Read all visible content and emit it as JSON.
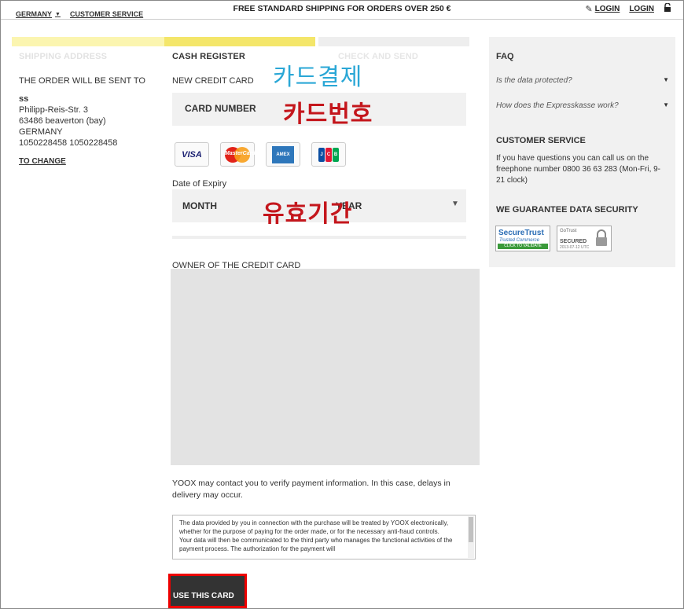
{
  "topbar": {
    "country": "GERMANY",
    "customer_service": "CUSTOMER SERVICE",
    "shipping_notice": "FREE STANDARD SHIPPING FOR ORDERS OVER 250 €",
    "login1": "LOGIN",
    "login2": "LOGIN"
  },
  "steps": {
    "step1": "SHIPPING ADDRESS",
    "step2": "CASH REGISTER",
    "step3": "CHECK AND SEND"
  },
  "address": {
    "heading": "THE ORDER WILL BE SENT TO",
    "name": "ss",
    "street": "Philipp-Reis-Str. 3",
    "city": "63486 beaverton (bay)",
    "country": "GERMANY",
    "phone": "1050228458 1050228458",
    "change_link": "TO CHANGE"
  },
  "form": {
    "new_card_label": "NEW CREDIT CARD",
    "card_number_placeholder": "CARD NUMBER",
    "card_logos": [
      "VISA",
      "MasterCard",
      "AMERICAN EXPRESS",
      "JCB"
    ],
    "expiry_label": "Date of Expiry",
    "month": "MONTH",
    "year": "YEAR",
    "owner_label": "OWNER OF THE CREDIT CARD",
    "contact_notice": "YOOX may contact you to verify payment information. In this case, delays in delivery may occur.",
    "terms_p1": "The data provided by you in connection with the purchase will be treated by YOOX electronically, whether for the purpose of paying for the order made, or for the necessary anti-fraud controls.",
    "terms_p2": "Your data will then be communicated to the third party who manages the functional activities of the payment process. The authorization for the payment will",
    "use_button": "USE THIS CARD"
  },
  "sidebar": {
    "faq_title": "FAQ",
    "faq_q1": "Is the data protected?",
    "faq_q2": "How does the Expresskasse work?",
    "cs_title": "CUSTOMER SERVICE",
    "cs_text": "If you have questions you can call us on the freephone number 0800 36 63 283 (Mon-Fri, 9-21 clock)",
    "security_title": "WE GUARANTEE DATA SECURITY",
    "badge1_title": "SecureTrust",
    "badge1_sub": "Trusted Commerce",
    "badge1_bar": "CLICK TO VALIDATE",
    "badge2_brand": "GoTrust",
    "badge2_title": "SECURED",
    "badge2_date": "2013-07-12 UTC"
  },
  "annotations": {
    "card_payment": "카드결제",
    "card_number": "카드번호",
    "expiry": "유효기간"
  },
  "colors": {
    "progress_light": "#fbf5b0",
    "progress_active": "#f4e66a",
    "highlight_red": "#e00000",
    "annotation_blue": "#2aa7d6",
    "annotation_red": "#c4161c"
  }
}
